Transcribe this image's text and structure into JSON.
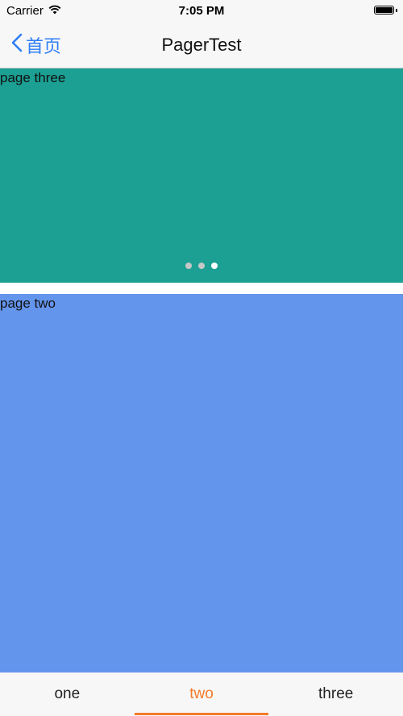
{
  "status_bar": {
    "carrier": "Carrier",
    "time": "7:05 PM",
    "wifi_icon": "wifi-icon",
    "battery_icon": "battery-icon"
  },
  "nav": {
    "back_label": "首页",
    "back_icon": "chevron-left-icon",
    "title": "PagerTest",
    "accent_color": "#2f7ef6"
  },
  "pager": {
    "page_label": "page three",
    "background": "#1ba093",
    "page_count": 3,
    "active_index": 2
  },
  "content": {
    "page_label": "page two",
    "background": "#6495ed"
  },
  "tabs": {
    "items": [
      {
        "label": "one"
      },
      {
        "label": "two"
      },
      {
        "label": "three"
      }
    ],
    "active_index": 1,
    "active_color": "#f47b2a"
  }
}
